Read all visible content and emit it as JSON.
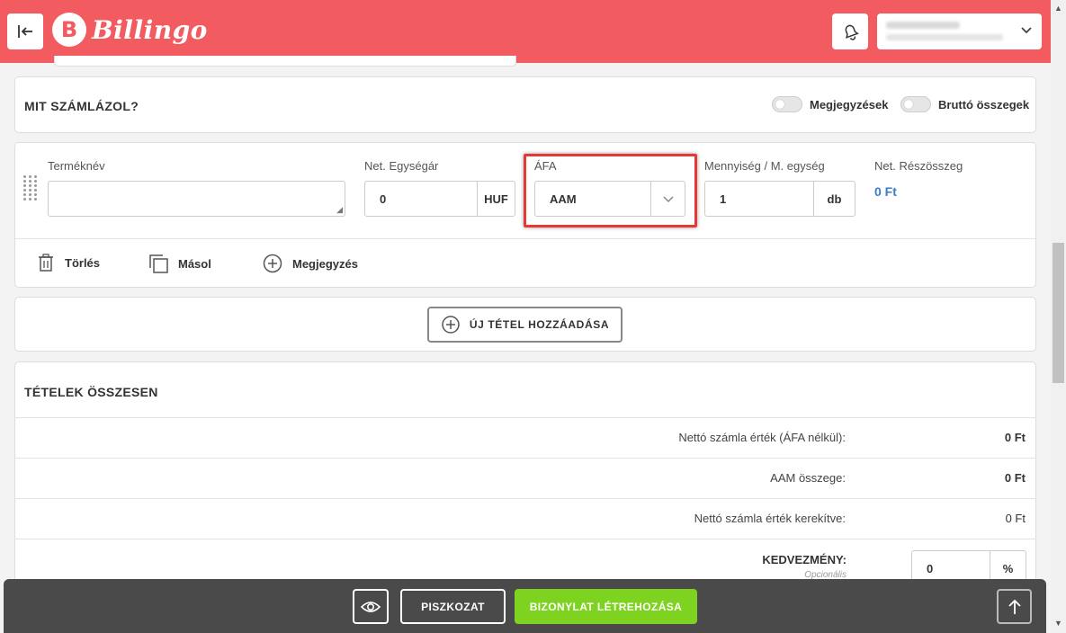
{
  "header": {
    "logo_letter": "B",
    "logo_text": "Billingo",
    "user_chevron": "⌄"
  },
  "section": {
    "title": "MIT SZÁMLÁZOL?",
    "toggles": [
      {
        "label": "Megjegyzések",
        "on": false
      },
      {
        "label": "Bruttó összegek",
        "on": false
      }
    ]
  },
  "item": {
    "name_label": "Terméknév",
    "name_value": "",
    "price_label": "Net. Egységár",
    "price_value": "0",
    "price_unit": "HUF",
    "vat_label": "ÁFA",
    "vat_value": "AAM",
    "qty_label": "Mennyiség / M. egység",
    "qty_value": "1",
    "qty_unit": "db",
    "subtotal_label": "Net. Részösszeg",
    "subtotal_value": "0 Ft",
    "actions": {
      "delete": "Törlés",
      "copy": "Másol",
      "note": "Megjegyzés"
    }
  },
  "add_item_button": "ÚJ TÉTEL HOZZÁADÁSA",
  "totals": {
    "title": "TÉTELEK ÖSSZESEN",
    "rows": [
      {
        "label": "Nettó számla érték (ÁFA nélkül):",
        "value": "0 Ft"
      },
      {
        "label": "AAM összege:",
        "value": "0 Ft"
      },
      {
        "label": "Nettó számla érték kerekítve:",
        "value": "0 Ft"
      }
    ],
    "discount_label": "KEDVEZMÉNY:",
    "discount_sub": "Opcionális",
    "discount_value": "0",
    "discount_unit": "%"
  },
  "bottom": {
    "draft": "PISZKOZAT",
    "create": "BIZONYLAT LÉTREHOZÁSA"
  },
  "colors": {
    "brand": "#f25b5f",
    "primary_button": "#7ed321",
    "subtotal": "#3b7dc4",
    "highlight": "#e53935"
  }
}
